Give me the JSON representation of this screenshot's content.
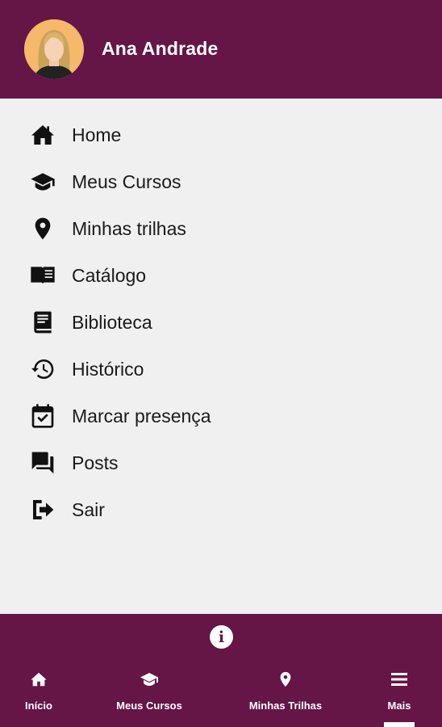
{
  "colors": {
    "primary": "#651546",
    "background": "#f0f0f0",
    "text": "#1a1a1a"
  },
  "user": {
    "name": "Ana Andrade",
    "avatar_icon": "user-avatar"
  },
  "menu": {
    "items": [
      {
        "label": "Home",
        "icon": "home-icon"
      },
      {
        "label": "Meus Cursos",
        "icon": "graduation-cap-icon"
      },
      {
        "label": "Minhas trilhas",
        "icon": "map-pin-icon"
      },
      {
        "label": "Catálogo",
        "icon": "open-book-icon"
      },
      {
        "label": "Biblioteca",
        "icon": "book-icon"
      },
      {
        "label": "Histórico",
        "icon": "history-icon"
      },
      {
        "label": "Marcar presença",
        "icon": "calendar-check-icon"
      },
      {
        "label": "Posts",
        "icon": "forum-icon"
      },
      {
        "label": "Sair",
        "icon": "logout-icon"
      }
    ]
  },
  "footer": {
    "info_icon": "info-icon",
    "nav": [
      {
        "label": "Início",
        "icon": "home-icon",
        "active": false
      },
      {
        "label": "Meus Cursos",
        "icon": "graduation-cap-icon",
        "active": false
      },
      {
        "label": "Minhas Trilhas",
        "icon": "map-pin-icon",
        "active": false
      },
      {
        "label": "Mais",
        "icon": "menu-icon",
        "active": true
      }
    ]
  }
}
